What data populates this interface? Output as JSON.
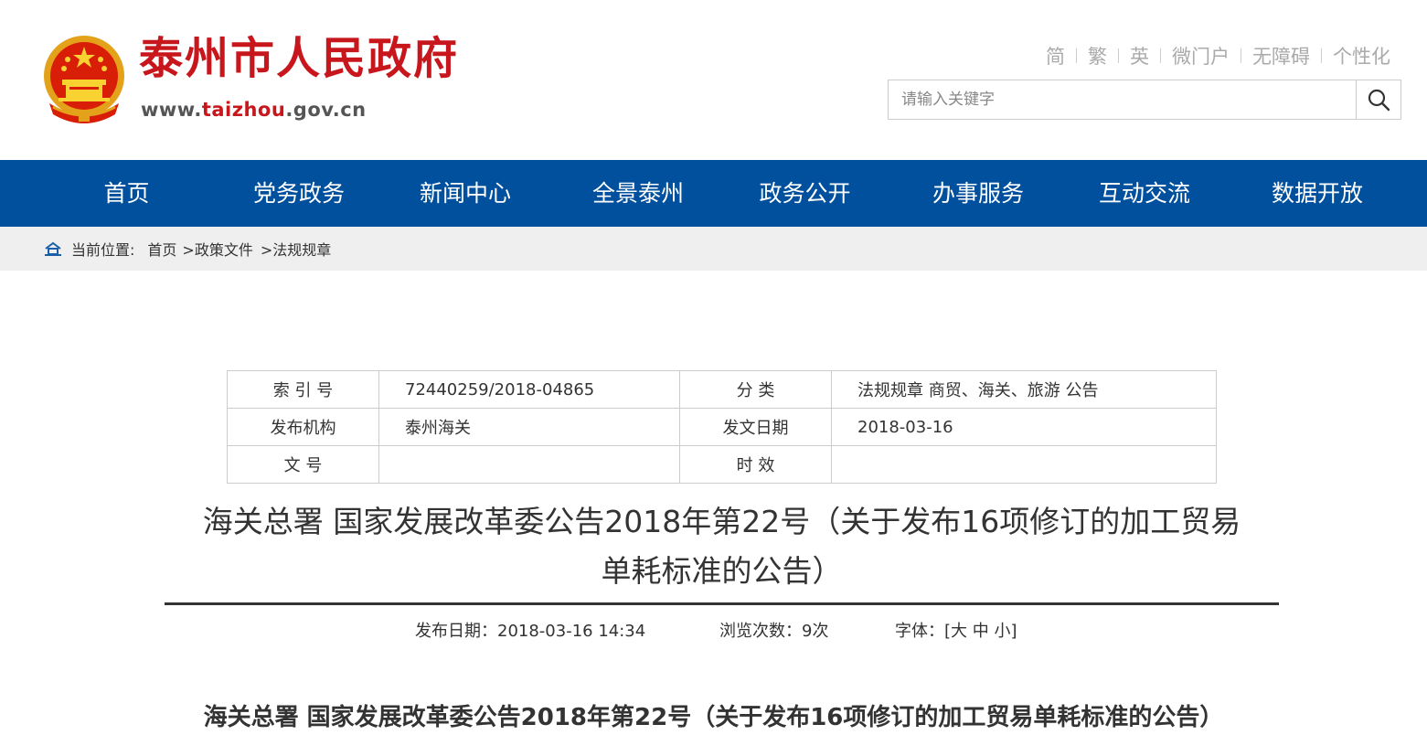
{
  "header": {
    "site_title": "泰州市人民政府",
    "site_url_pre": "www.",
    "site_url_hl": "taizhou",
    "site_url_post": ".gov.cn",
    "top_links": [
      "简",
      "繁",
      "英",
      "微门户",
      "无障碍",
      "个性化"
    ],
    "search_placeholder": "请输入关键字"
  },
  "nav": {
    "items": [
      "首页",
      "党务政务",
      "新闻中心",
      "全景泰州",
      "政务公开",
      "办事服务",
      "互动交流",
      "数据开放"
    ]
  },
  "breadcrumb": {
    "label": "当前位置:",
    "items": [
      "首页",
      ">政策文件",
      ">法规规章"
    ]
  },
  "info_table": {
    "rows": [
      [
        "索 引 号",
        "72440259/2018-04865",
        "分 类",
        "法规规章 商贸、海关、旅游 公告"
      ],
      [
        "发布机构",
        "泰州海关",
        "发文日期",
        "2018-03-16"
      ],
      [
        "文 号",
        "",
        "时 效",
        ""
      ]
    ]
  },
  "article": {
    "title_line1": "海关总署 国家发展改革委公告2018年第22号（关于发布16项修订的加工贸易",
    "title_line2": "单耗标准的公告）",
    "publish_date": "发布日期：2018-03-16 14:34",
    "views": "浏览次数：9次",
    "font_size_label": "字体：[",
    "font_large": "大",
    "font_medium": "中",
    "font_small": "小",
    "font_size_close": "]",
    "subtitle": "海关总署 国家发展改革委公告2018年第22号（关于发布16项修订的加工贸易单耗标准的公告）"
  },
  "colors": {
    "brand_red": "#c8161d",
    "nav_blue": "#00509d",
    "crumb_bg": "#efefef"
  }
}
